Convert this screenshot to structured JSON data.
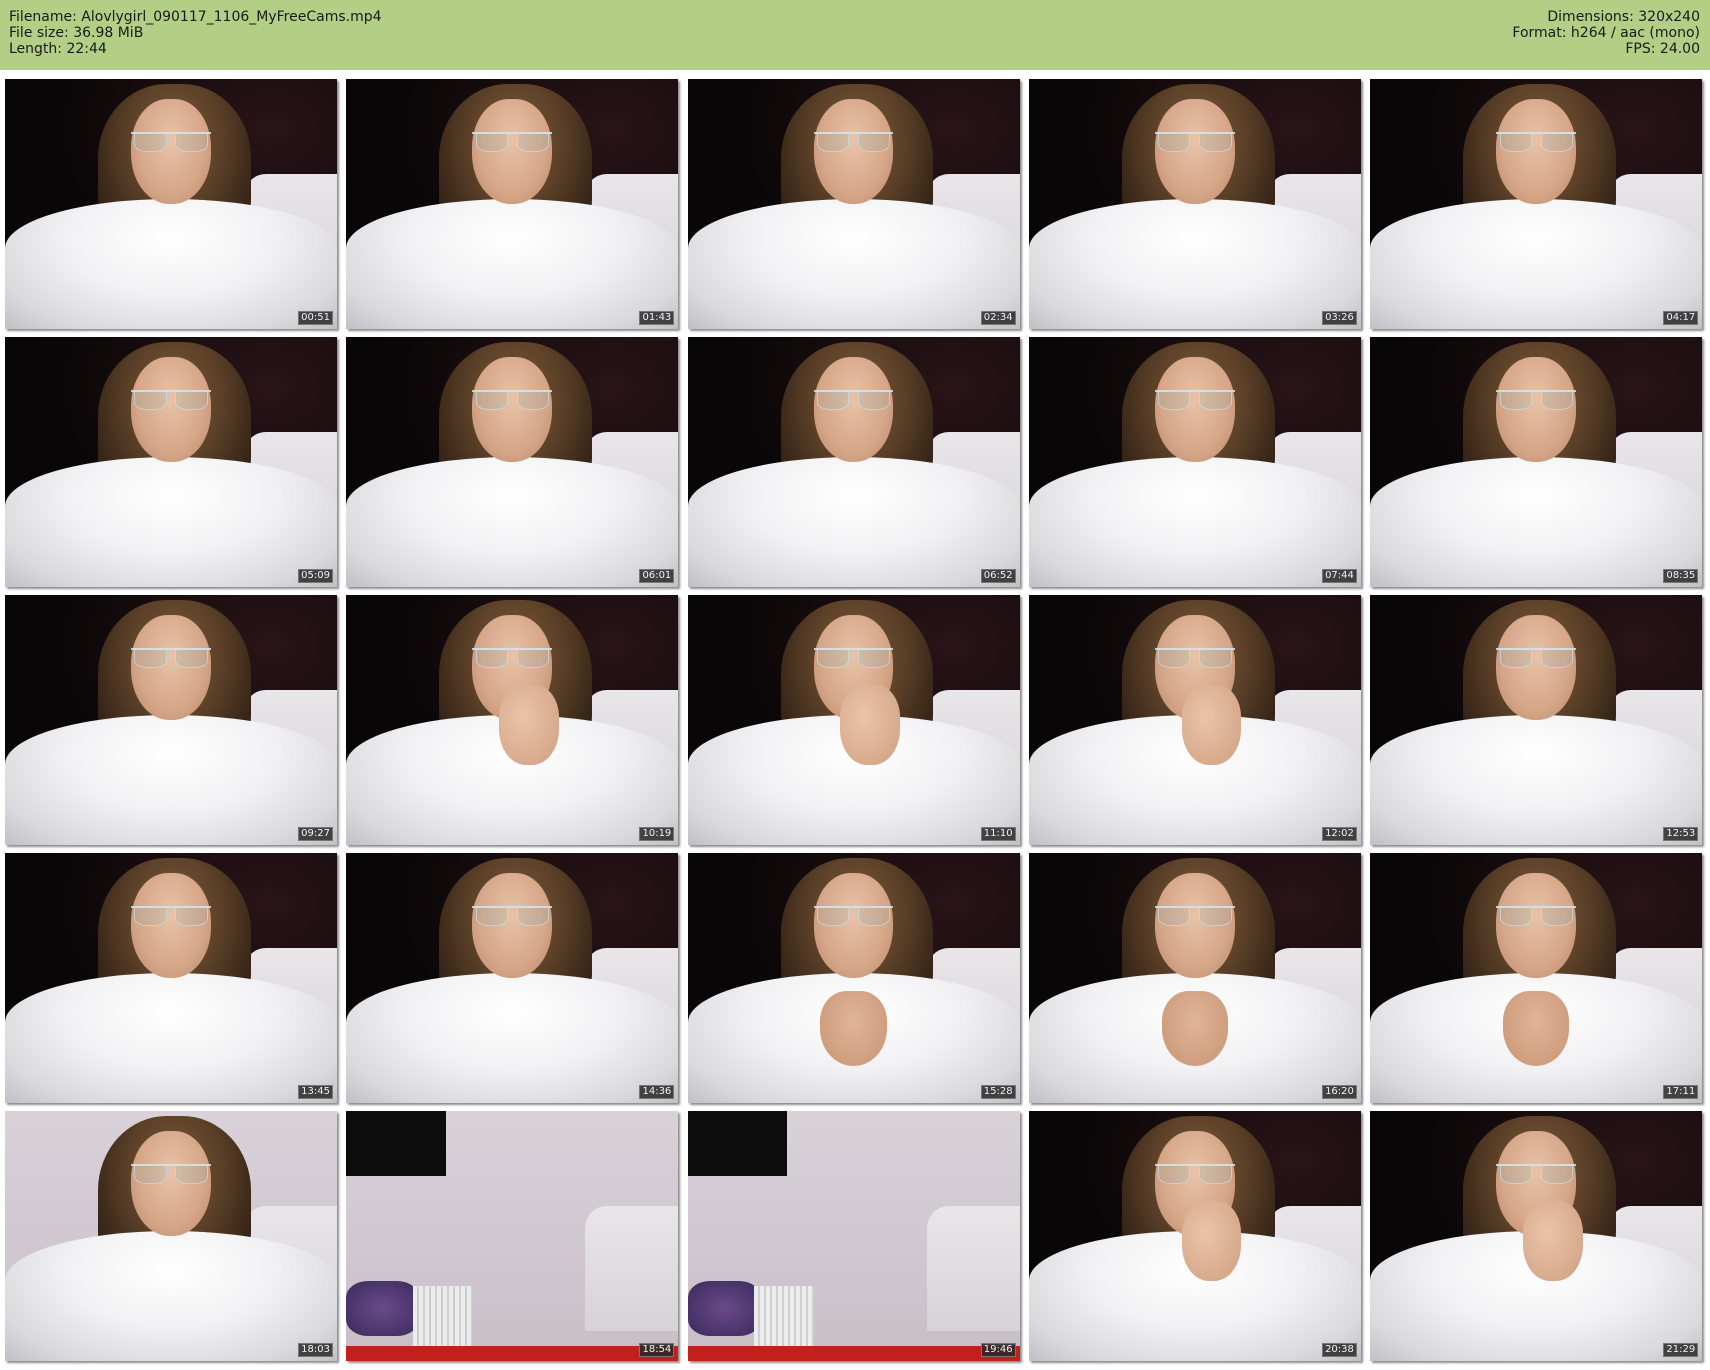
{
  "header": {
    "filename": "Filename: Alovlygirl_090117_1106_MyFreeCams.mp4",
    "filesize": "File size: 36.98 MiB",
    "length": "Length: 22:44",
    "dimensions": "Dimensions: 320x240",
    "format": "Format: h264 / aac (mono)",
    "fps": "FPS: 24.00",
    "background_color": "#b2cf85"
  },
  "thumbnails": [
    {
      "time": "00:51"
    },
    {
      "time": "01:43"
    },
    {
      "time": "02:34"
    },
    {
      "time": "03:26"
    },
    {
      "time": "04:17"
    },
    {
      "time": "05:09"
    },
    {
      "time": "06:01"
    },
    {
      "time": "06:52"
    },
    {
      "time": "07:44"
    },
    {
      "time": "08:35"
    },
    {
      "time": "09:27"
    },
    {
      "time": "10:19"
    },
    {
      "time": "11:10"
    },
    {
      "time": "12:02"
    },
    {
      "time": "12:53"
    },
    {
      "time": "13:45"
    },
    {
      "time": "14:36"
    },
    {
      "time": "15:28"
    },
    {
      "time": "16:20"
    },
    {
      "time": "17:11"
    },
    {
      "time": "18:03"
    },
    {
      "time": "18:54"
    },
    {
      "time": "19:46"
    },
    {
      "time": "20:38"
    },
    {
      "time": "21:29"
    }
  ]
}
